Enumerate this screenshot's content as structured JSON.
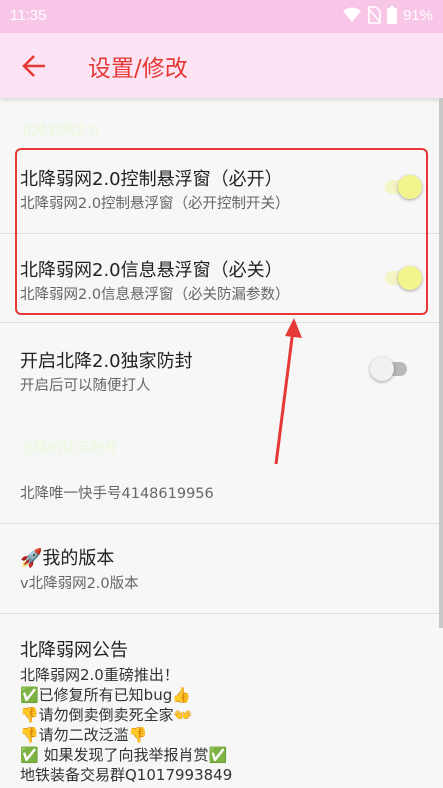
{
  "status_bar": {
    "time": "11:35",
    "battery": "91%"
  },
  "app_bar": {
    "title": "设置/修改",
    "back_icon": "arrow-left-icon"
  },
  "categories": {
    "beijiang": "北降弱网2.0",
    "kuaishou": "北降的快手账号"
  },
  "prefs": {
    "control_float": {
      "title": "北降弱网2.0控制悬浮窗（必开）",
      "summary": "北降弱网2.0控制悬浮窗（必开控制开关）",
      "enabled": true
    },
    "info_float": {
      "title": "北降弱网2.0信息悬浮窗（必关）",
      "summary": "北降弱网2.0信息悬浮窗（必关防漏参数）",
      "enabled": true
    },
    "anti_ban": {
      "title": "开启北降2.0独家防封",
      "summary": "开启后可以随便打人",
      "enabled": false
    },
    "kuaishou_id": {
      "summary": "北降唯一快手号4148619956"
    },
    "version": {
      "title": "🚀我的版本",
      "summary": "v北降弱网2.0版本"
    },
    "notice": {
      "title": "北降弱网公告",
      "lines": [
        " 北降弱网2.0重磅推出！",
        "✅已修复所有已知bug👍",
        "👎请勿倒卖倒卖死全家👐",
        "👎请勿二改泛滥👎",
        "✅ 如果发现了向我举报肖赏✅",
        "地铁装备交易群Q1017993849"
      ]
    }
  },
  "colors": {
    "status_bar": "#f8c6e6",
    "app_bar": "#fde4f4",
    "accent": "#e53935",
    "category_text": "#e8f8d8",
    "switch_on_thumb": "#f2f58e"
  }
}
